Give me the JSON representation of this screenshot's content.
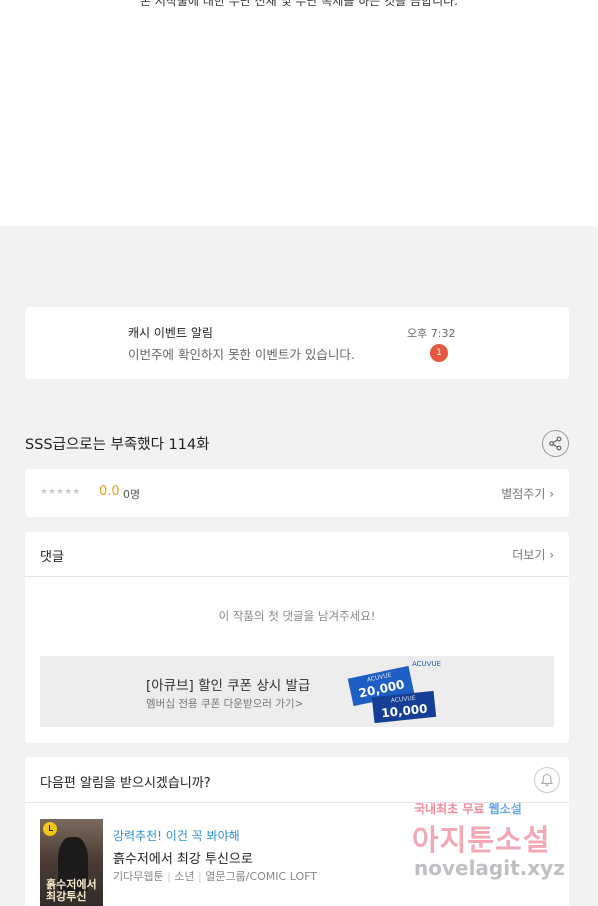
{
  "top_notice": {
    "text": "본 저작물에 대한 무단 전재 및 무단 복제를 하는 것을 금합니다."
  },
  "notification": {
    "title": "캐시 이벤트 알림",
    "time": "오후 7:32",
    "message": "이번주에 확인하지 못한 이벤트가 있습니다.",
    "badge_count": "1",
    "badge_color": "#e5573e"
  },
  "episode": {
    "title": "SSS급으로는 부족했다 114화",
    "share_icon": "share-icon"
  },
  "rating": {
    "stars": "★★★★★",
    "score": "0.0",
    "count": "0명",
    "rate_link": "별점주기 ›",
    "score_color": "#f0a01b"
  },
  "comments": {
    "label": "댓글",
    "more_link": "더보기 ›",
    "empty_message": "이 작품의 첫 댓글을 남겨주세요!"
  },
  "ad": {
    "title": "[아큐브] 할인 쿠폰 상시 발급",
    "subtitle": "멤버십 전용 쿠폰 다운받으러 가기>",
    "brand": "ACUVUE",
    "coupon_1_brand": "ACUVUE",
    "coupon_1_value": "20,000",
    "coupon_2_brand": "ACUVUE",
    "coupon_2_value": "10,000"
  },
  "subscribe": {
    "label": "다음편 알림을 받으시겠습니까?",
    "bell_icon": "bell-icon"
  },
  "recommendation": {
    "tag": "강력추천! 이건 꼭 봐야해",
    "title": "흙수저에서 최강 투신으로",
    "meta_1": "기다무웹툰",
    "meta_2": "소년",
    "meta_3": "열문그룹/COMIC LOFT",
    "thumb_title": "흙수저에서 최강투신",
    "tag_color": "#2e8fd6"
  },
  "watermark": {
    "line1_a": "국내최초 무료",
    "line1_b": "웹소설",
    "line2": "아지툰소설",
    "line3": "novelagit.xyz"
  }
}
